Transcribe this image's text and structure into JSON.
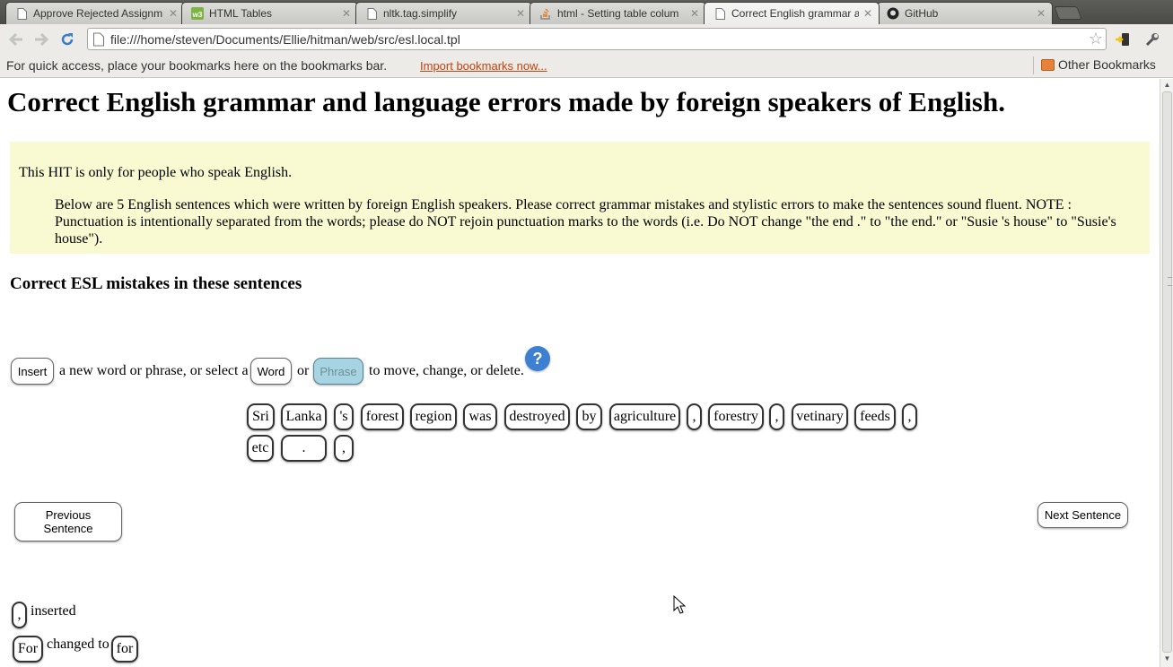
{
  "browser": {
    "tabs": [
      {
        "title": "Approve Rejected Assignm",
        "icon": "page-icon"
      },
      {
        "title": "HTML Tables",
        "icon": "w3schools-icon"
      },
      {
        "title": "nltk.tag.simplify",
        "icon": "page-icon"
      },
      {
        "title": "html - Setting table colum",
        "icon": "stackoverflow-icon"
      },
      {
        "title": "Correct English grammar a",
        "icon": "page-icon"
      },
      {
        "title": "GitHub",
        "icon": "github-icon"
      }
    ],
    "url": "file:///home/steven/Documents/Ellie/hitman/web/src/esl.local.tpl",
    "bookmarks_hint": "For quick access, place your bookmarks here on the bookmarks bar.",
    "import_bookmarks": "Import bookmarks now...",
    "other_bookmarks": "Other Bookmarks"
  },
  "page": {
    "title": "Correct English grammar and language errors made by foreign speakers of English.",
    "notice_lead": "This HIT is only for people who speak English.",
    "notice_body": "Below are 5 English sentences which were written by foreign English speakers. Please correct grammar mistakes and stylistic errors to make the sentences sound fluent. NOTE : Punctuation is intentionally separated from the words; please do NOT rejoin punctuation marks to the words (i.e. Do NOT change \"the end .\" to \"the end.\" or \"Susie 's house\" to \"Susie's house\").",
    "section_heading": "Correct ESL mistakes in these sentences",
    "instructions": {
      "insert_button": "Insert",
      "text_1": "a new word or phrase, or select a",
      "word_button": "Word",
      "text_2": "or",
      "phrase_button": "Phrase",
      "text_3": "to move, change, or delete.",
      "help": "?"
    },
    "sentence_tokens": [
      "Sri",
      "Lanka",
      "'s",
      "forest",
      "region",
      "was",
      "destroyed",
      "by",
      "agriculture",
      ",",
      "forestry",
      ",",
      "vetinary",
      "feeds",
      ",",
      "etc",
      ".",
      ","
    ],
    "prev_button": "Previous Sentence",
    "next_button": "Next Sentence",
    "edits": [
      {
        "token": ",",
        "text": "inserted"
      },
      {
        "token": "For",
        "text": "changed to",
        "new_token": "for"
      }
    ]
  },
  "colors": {
    "notice_bg": "#fafad2",
    "disabled_button_bg": "#a7d4e3",
    "help_icon_bg": "#3d7fd1",
    "import_link": "#c2410c"
  }
}
